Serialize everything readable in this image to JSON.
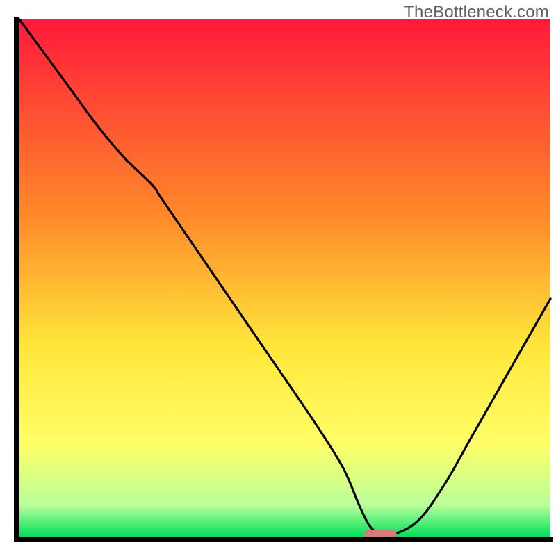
{
  "watermark": "TheBottleneck.com",
  "colors": {
    "axis": "#000000",
    "curve": "#000000",
    "marker_fill": "#d97a7a",
    "marker_stroke": "#d97a7a",
    "grad_red": "#ff1a3a",
    "grad_orange": "#ff8a2a",
    "grad_yellow": "#ffe63a",
    "grad_yellow2": "#ffff66",
    "grad_palegreen": "#b8ff9a",
    "grad_green": "#00e05a"
  },
  "chart_data": {
    "type": "line",
    "title": "",
    "xlabel": "",
    "ylabel": "",
    "xlim": [
      0,
      100
    ],
    "ylim": [
      0,
      100
    ],
    "x": [
      0,
      5,
      10,
      15,
      20,
      25,
      27,
      35,
      45,
      55,
      60,
      62,
      64,
      66,
      68,
      70,
      75,
      80,
      85,
      90,
      95,
      100
    ],
    "values": [
      100,
      93,
      86,
      79,
      73,
      68,
      65,
      53,
      38,
      23,
      15,
      11,
      6,
      2,
      0.5,
      0.3,
      3,
      10,
      19,
      28,
      37,
      46
    ],
    "minimum": {
      "x_start": 65,
      "x_end": 71,
      "y": 0.3
    },
    "annotations": []
  }
}
